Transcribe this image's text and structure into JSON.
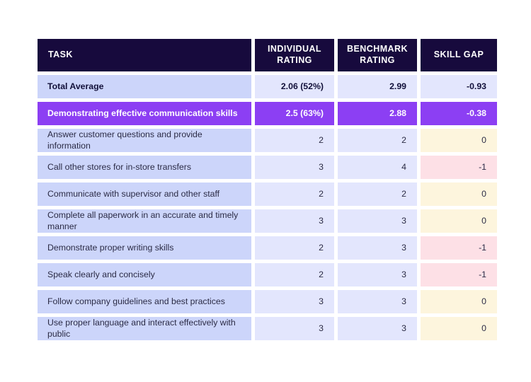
{
  "table": {
    "columns": [
      {
        "key": "task",
        "label": "TASK"
      },
      {
        "key": "individual",
        "label": "INDIVIDUAL\nRATING",
        "line1": "INDIVIDUAL",
        "line2": "RATING"
      },
      {
        "key": "benchmark",
        "label": "BENCHMARK\nRATING",
        "line1": "BENCHMARK",
        "line2": "RATING"
      },
      {
        "key": "skillgap",
        "label": "SKILL GAP"
      }
    ],
    "total_row": {
      "task": "Total Average",
      "individual": "2.06 (52%)",
      "benchmark": "2.99",
      "skillgap": "-0.93"
    },
    "highlight_row": {
      "task": "Demonstrating effective communication skills",
      "individual": "2.5 (63%)",
      "benchmark": "2.88",
      "skillgap": "-0.38"
    },
    "rows": [
      {
        "task": "Answer customer questions and provide information",
        "individual": "2",
        "benchmark": "2",
        "skillgap": "0",
        "gap_state": "zero"
      },
      {
        "task": "Call other stores for in-store transfers",
        "individual": "3",
        "benchmark": "4",
        "skillgap": "-1",
        "gap_state": "neg"
      },
      {
        "task": "Communicate with supervisor and other staff",
        "individual": "2",
        "benchmark": "2",
        "skillgap": "0",
        "gap_state": "zero"
      },
      {
        "task": "Complete all paperwork in an accurate and timely manner",
        "individual": "3",
        "benchmark": "3",
        "skillgap": "0",
        "gap_state": "zero"
      },
      {
        "task": "Demonstrate proper writing skills",
        "individual": "2",
        "benchmark": "3",
        "skillgap": "-1",
        "gap_state": "neg"
      },
      {
        "task": "Speak clearly and concisely",
        "individual": "2",
        "benchmark": "3",
        "skillgap": "-1",
        "gap_state": "neg"
      },
      {
        "task": "Follow company guidelines and best practices",
        "individual": "3",
        "benchmark": "3",
        "skillgap": "0",
        "gap_state": "zero"
      },
      {
        "task": "Use proper language and interact effectively with public",
        "individual": "3",
        "benchmark": "3",
        "skillgap": "0",
        "gap_state": "zero"
      }
    ]
  },
  "colors": {
    "header_bg": "#170a3d",
    "task_cell_bg": "#ccd5fa",
    "value_cell_bg": "#e3e6fd",
    "highlight_bg": "#8c3ff3",
    "gap_zero_bg": "#fdf5dd",
    "gap_negative_bg": "#fde0e6",
    "text_dark": "#2b2b45",
    "text_light": "#ffffff"
  }
}
